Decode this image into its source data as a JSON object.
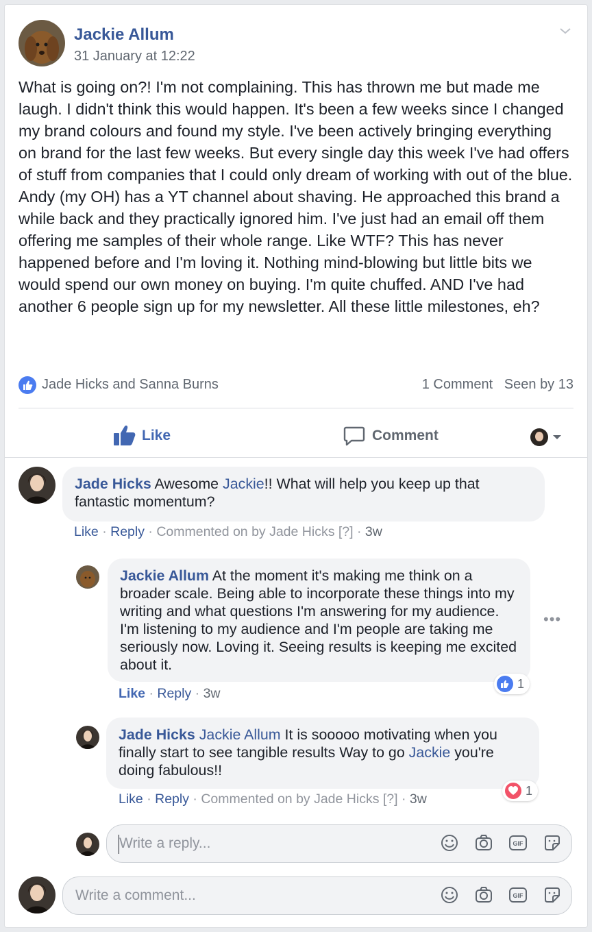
{
  "post": {
    "author": "Jackie Allum",
    "timestamp": "31 January at 12:22",
    "body": "What is going on?! I'm not complaining. This has thrown me but made me laugh. I didn't think this would happen. It's been a few weeks since I changed my brand colours and found my style. I've been actively bringing everything on brand for the last few weeks. But every single day this week I've had offers of stuff from companies that I could only dream of working with out of the blue. Andy (my OH) has a YT channel about shaving. He approached this brand a while back and they practically ignored him. I've just had an email off them offering me samples of their whole range. Like WTF? This has never happened before and I'm loving it. Nothing mind-blowing but little bits we would spend our own money on buying. I'm quite chuffed. AND I've had another 6 people sign up for my newsletter. All these little milestones, eh?",
    "reactions_names": "Jade Hicks and Sanna Burns",
    "comment_count": "1 Comment",
    "seen_by": "Seen by 13"
  },
  "actions": {
    "like": "Like",
    "comment": "Comment"
  },
  "comments": [
    {
      "author": "Jade Hicks",
      "text_before": " Awesome ",
      "mention": "Jackie",
      "text_after": "!! What will help you keep up that fantastic momentum?",
      "like": "Like",
      "reply": "Reply",
      "note": "Commented on by Jade Hicks",
      "help": "[?]",
      "age": "3w"
    },
    {
      "author": "Jackie Allum",
      "text": " At the moment it's making me think on a broader scale. Being able to incorporate these things into my writing and what questions I'm answering for my audience. I'm listening to my audience and I'm people are taking me seriously now. Loving it. Seeing results is keeping me excited about it.",
      "like": "Like",
      "reply": "Reply",
      "age": "3w",
      "reaction_count": "1",
      "options": "•••"
    },
    {
      "author": "Jade Hicks",
      "mention1": " Jackie Allum",
      "text_mid": " It is sooooo motivating when you finally start to see tangible results Way to go ",
      "mention2": "Jackie",
      "text_after": " you're doing fabulous!!",
      "like": "Like",
      "reply": "Reply",
      "note": "Commented on by Jade Hicks",
      "help": "[?]",
      "age": "3w",
      "reaction_count": "1"
    }
  ],
  "reply_input": {
    "placeholder": "Write a reply..."
  },
  "comment_input": {
    "placeholder": "Write a comment..."
  },
  "colors": {
    "link": "#385898",
    "like_blue": "#4267b2",
    "love_red": "#f25268",
    "bubble": "#f2f3f5"
  }
}
